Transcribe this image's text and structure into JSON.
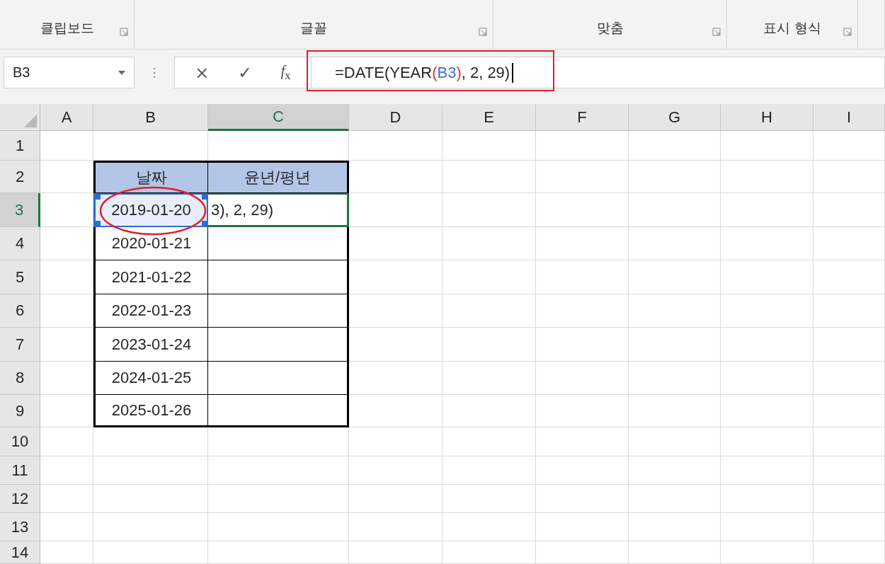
{
  "ribbon": {
    "groups": [
      {
        "label": "클립보드"
      },
      {
        "label": "글꼴"
      },
      {
        "label": "맞춤"
      },
      {
        "label": "표시 형식"
      }
    ]
  },
  "formula_bar": {
    "name_box": "B3",
    "cancel": "×",
    "enter": "✓",
    "function_label": "*f*$_{x}$",
    "highlighted": true,
    "formula_parts": [
      {
        "text": "=DATE(YEAR",
        "color": "#262626"
      },
      {
        "text": "(",
        "color": "#d03a3a"
      },
      {
        "text": "B3",
        "color": "#3e6fd8"
      },
      {
        "text": ")",
        "color": "#d03a3a"
      },
      {
        "text": ", 2, 29)",
        "color": "#262626"
      }
    ]
  },
  "sheet": {
    "columns": [
      {
        "label": "A",
        "selected": false
      },
      {
        "label": "B",
        "selected": false
      },
      {
        "label": "C",
        "selected": true
      },
      {
        "label": "D",
        "selected": false
      },
      {
        "label": "E",
        "selected": false
      },
      {
        "label": "F",
        "selected": false
      },
      {
        "label": "G",
        "selected": false
      },
      {
        "label": "H",
        "selected": false
      },
      {
        "label": "I",
        "selected": false
      }
    ],
    "rows": [
      {
        "label": "1",
        "selected": false
      },
      {
        "label": "2",
        "selected": false
      },
      {
        "label": "3",
        "selected": true
      },
      {
        "label": "4",
        "selected": false
      },
      {
        "label": "5",
        "selected": false
      },
      {
        "label": "6",
        "selected": false
      },
      {
        "label": "7",
        "selected": false
      },
      {
        "label": "8",
        "selected": false
      },
      {
        "label": "9",
        "selected": false
      },
      {
        "label": "10",
        "selected": false
      },
      {
        "label": "11",
        "selected": false
      },
      {
        "label": "12",
        "selected": false
      },
      {
        "label": "13",
        "selected": false
      },
      {
        "label": "14",
        "selected": false
      }
    ],
    "table": {
      "headers": [
        "날짜",
        "윤년/평년"
      ],
      "rows": [
        {
          "date": "2019-01-20",
          "selected": true,
          "circled": true,
          "result": "3), 2, 29)",
          "editing": true
        },
        {
          "date": "2020-01-21",
          "selected": false,
          "circled": false,
          "editing": false
        },
        {
          "date": "2021-01-22",
          "selected": false,
          "circled": false,
          "editing": false
        },
        {
          "date": "2022-01-23",
          "selected": false,
          "circled": false,
          "editing": false
        },
        {
          "date": "2023-01-24",
          "selected": false,
          "circled": false,
          "editing": false
        },
        {
          "date": "2024-01-25",
          "selected": false,
          "circled": false,
          "editing": false
        },
        {
          "date": "2025-01-26",
          "selected": false,
          "circled": false,
          "editing": false
        }
      ]
    }
  }
}
